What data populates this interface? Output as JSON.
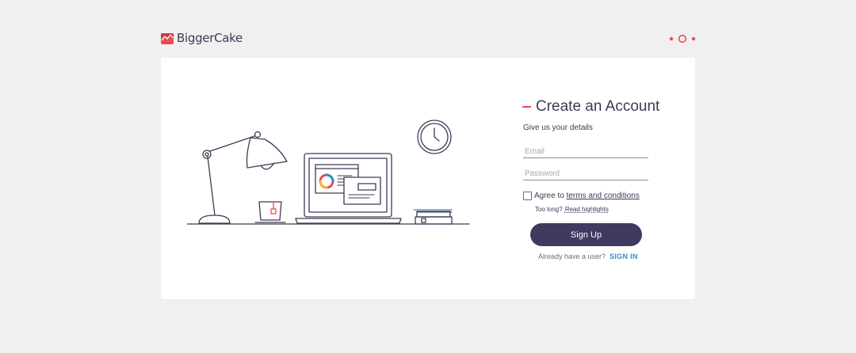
{
  "brand": {
    "name": "BiggerCake",
    "accent_color": "#e84d55",
    "primary_color": "#403a5e",
    "link_color": "#2e8fc4"
  },
  "header": {
    "menu_icon": "three-dots-menu-icon"
  },
  "form": {
    "title": "Create an Account",
    "subtitle": "Give us your details",
    "email_placeholder": "Email",
    "password_placeholder": "Password",
    "agree_prefix": "Agree to",
    "terms_link": "terms and conditions",
    "too_long": "Too long?",
    "read_highlights": "Read highlights",
    "signup_button": "Sign Up",
    "already_user": "Already have a user?",
    "signin_link": "SIGN IN"
  },
  "illustration": {
    "description_icon": "desk-illustration"
  }
}
